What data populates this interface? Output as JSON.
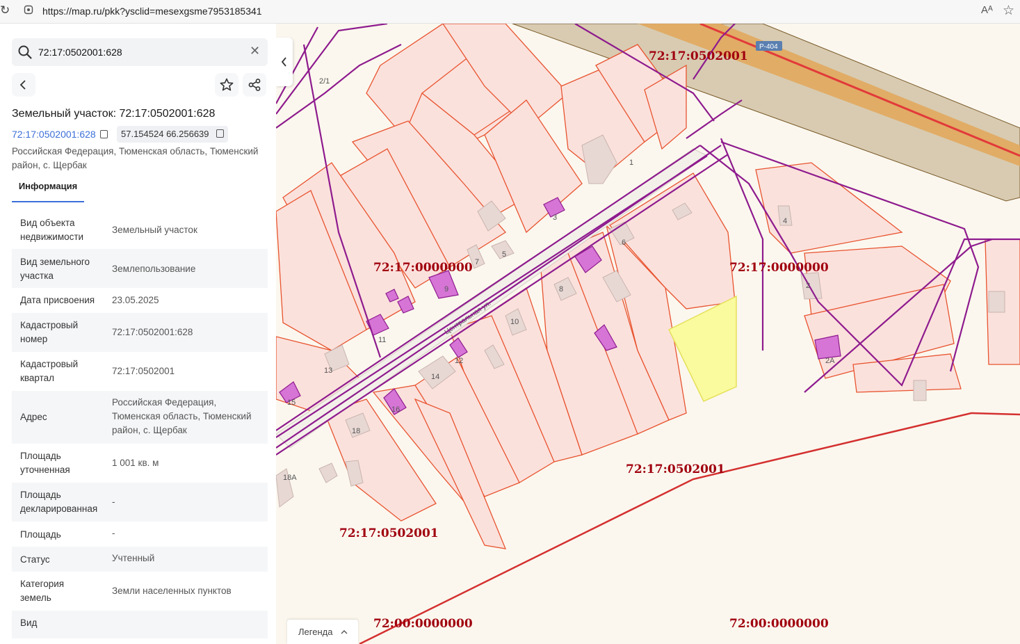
{
  "browser": {
    "url": "https://map.ru/pkk?ysclid=mesexgsme7953185341",
    "reload_icon": "reload-icon",
    "read_aloud": "Aᴬ"
  },
  "sidebar": {
    "search": {
      "value": "72:17:0502001:628"
    },
    "title": "Земельный участок: 72:17:0502001:628",
    "cadastral_link": "72:17:0502001:628",
    "coordinates": "57.154524 66.256639",
    "address_line1": "Российская Федерация, Тюменская область, Тюменский",
    "address_line2": "район, с. Щербак",
    "tab": "Информация",
    "rows": [
      {
        "label1": "Вид объекта",
        "label2": "недвижимости",
        "value1": "Земельный участок",
        "value2": "",
        "value3": ""
      },
      {
        "label1": "Вид земельного",
        "label2": "участка",
        "value1": "Землепользование",
        "value2": "",
        "value3": ""
      },
      {
        "label1": "Дата присвоения",
        "label2": "",
        "value1": "23.05.2025",
        "value2": "",
        "value3": ""
      },
      {
        "label1": "Кадастровый",
        "label2": "номер",
        "value1": "72:17:0502001:628",
        "value2": "",
        "value3": ""
      },
      {
        "label1": "Кадастровый",
        "label2": "квартал",
        "value1": "72:17:0502001",
        "value2": "",
        "value3": ""
      },
      {
        "label1": "Адрес",
        "label2": "",
        "value1": "Российская Федерация,",
        "value2": "Тюменская область, Тюменский",
        "value3": "район, с. Щербак"
      },
      {
        "label1": "Площадь",
        "label2": "уточненная",
        "value1": "1 001 кв. м",
        "value2": "",
        "value3": ""
      },
      {
        "label1": "Площадь",
        "label2": "декларированная",
        "value1": "-",
        "value2": "",
        "value3": ""
      },
      {
        "label1": "Площадь",
        "label2": "",
        "value1": "-",
        "value2": "",
        "value3": ""
      },
      {
        "label1": "Статус",
        "label2": "",
        "value1": "Учтенный",
        "value2": "",
        "value3": ""
      },
      {
        "label1": "Категория",
        "label2": "земель",
        "value1": "Земли населенных пунктов",
        "value2": "",
        "value3": ""
      },
      {
        "label1": "Вид",
        "label2": "",
        "value1": "",
        "value2": "",
        "value3": ""
      }
    ]
  },
  "map": {
    "legend": "Легенда",
    "road_badge": "Р-404",
    "street_name": "Центральная ул.",
    "quarter_labels": [
      "72:17:0502001",
      "72:17:0000000",
      "72:17:0000000",
      "72:17:0502001",
      "72:17:0502001",
      "72:00:0000000",
      "72:00:0000000"
    ],
    "plot_numbers": [
      "2/1",
      "1",
      "3",
      "4",
      "5",
      "6",
      "7",
      "8",
      "9",
      "10",
      "11",
      "12",
      "13",
      "14",
      "15",
      "16",
      "18",
      "18А",
      "2",
      "2А"
    ],
    "colors": {
      "parcel_fill": "#fbe1dc",
      "parcel_stroke": "#e8532f",
      "power_line": "#8e1b8e",
      "selected": "#fafa9e",
      "quarter_label": "#a0000e",
      "road": "#c8b99a"
    }
  }
}
